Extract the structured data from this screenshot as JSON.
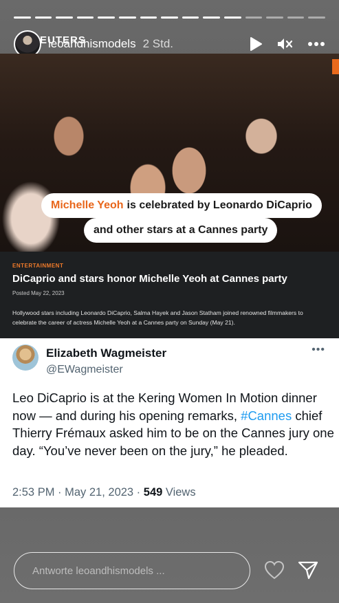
{
  "story": {
    "progress_segments": [
      1,
      1,
      1,
      1,
      1,
      1,
      1,
      1,
      1,
      1,
      1,
      0,
      0,
      0,
      0
    ],
    "user": "leoandhismodels",
    "time": "2 Std.",
    "icons": [
      "play-icon",
      "mute-icon",
      "more-icon"
    ]
  },
  "article": {
    "source_logo": "EUTERS",
    "caption_highlight": "Michelle Yeoh",
    "caption_line1_rest": "is celebrated by Leonardo DiCaprio",
    "caption_line2": "and other stars at a Cannes party",
    "category": "ENTERTAINMENT",
    "headline": "DiCaprio and stars honor Michelle Yeoh at Cannes party",
    "posted": "Posted May 22, 2023",
    "summary": "Hollywood stars including Leonardo DiCaprio, Salma Hayek and Jason Statham joined renowned filmmakers to celebrate the career of actress Michelle Yeoh at a Cannes party on Sunday (May 21)."
  },
  "tweet": {
    "name": "Elizabeth Wagmeister",
    "handle": "@EWagmeister",
    "more": "•••",
    "text_before": "Leo DiCaprio is at the Kering Women In Motion dinner now — and during his opening remarks, ",
    "hashtag": "#Cannes",
    "text_after": " chief Thierry Frémaux asked him to be on the Cannes jury one day. “You’ve never been on the jury,” he pleaded.",
    "meta_time": "2:53 PM · May 21, 2023 · ",
    "views_count": "549",
    "views_label": " Views"
  },
  "reply": {
    "placeholder": "Antworte leoandhismodels ..."
  },
  "colors": {
    "accent_orange": "#e8661b",
    "link_blue": "#1d9bf0"
  }
}
